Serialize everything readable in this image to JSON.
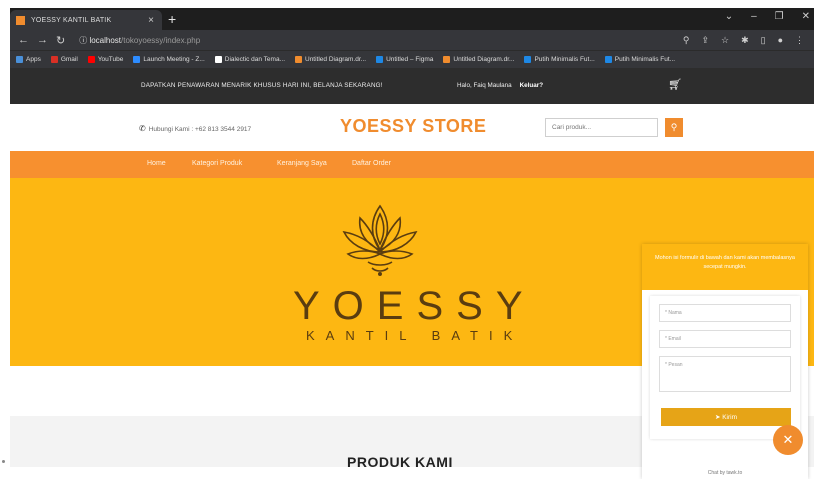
{
  "browser": {
    "tab_title": "YOESSY KANTIL BATIK",
    "tab_close": "×",
    "new_tab": "+",
    "url_host": "localhost",
    "url_path": "/tokoyoessy/index.php",
    "bookmarks": [
      {
        "label": "Apps",
        "color": "#4a90d9"
      },
      {
        "label": "Gmail",
        "color": "#d93025"
      },
      {
        "label": "YouTube",
        "color": "#ff0000"
      },
      {
        "label": "Launch Meeting - Z...",
        "color": "#2d8cff"
      },
      {
        "label": "Dialectic dan Tema...",
        "color": "#ffffff"
      },
      {
        "label": "Untitled Diagram.dr...",
        "color": "#f08c2e"
      },
      {
        "label": "Untitled – Figma",
        "color": "#1e88e5"
      },
      {
        "label": "Untitled Diagram.dr...",
        "color": "#f08c2e"
      },
      {
        "label": "Putih Minimalis Fut...",
        "color": "#1e88e5"
      },
      {
        "label": "Putih Minimalis Fut...",
        "color": "#1e88e5"
      }
    ]
  },
  "topbar": {
    "promo": "DAPATKAN PENAWARAN MENARIK KHUSUS HARI INI, BELANJA SEKARANG!",
    "greeting": "Halo, Faiq Maulana",
    "logout": "Keluar?"
  },
  "header": {
    "phone": "Hubungi Kami : +62 813 3544 2917",
    "brand": "YOESSY STORE",
    "search_placeholder": "Cari produk..."
  },
  "menu": [
    "Home",
    "Kategori Produk",
    "Keranjang Saya",
    "Daftar Order"
  ],
  "hero": {
    "logo_word": "YOESSY",
    "logo_sub": "KANTIL BATIK"
  },
  "chat": {
    "header": "Mohon isi formulir di bawah dan kami akan membalasnya secepat mungkin.",
    "name_placeholder": "* Nama",
    "email_placeholder": "* Email",
    "message_placeholder": "* Pesan",
    "send_label": "Kirim",
    "footer": "Chat by tawk.to"
  },
  "section_title": "PRODUK KAMI",
  "colors": {
    "accent": "#f08c2e",
    "hero": "#fdb712",
    "dark": "#2d2d2d"
  }
}
